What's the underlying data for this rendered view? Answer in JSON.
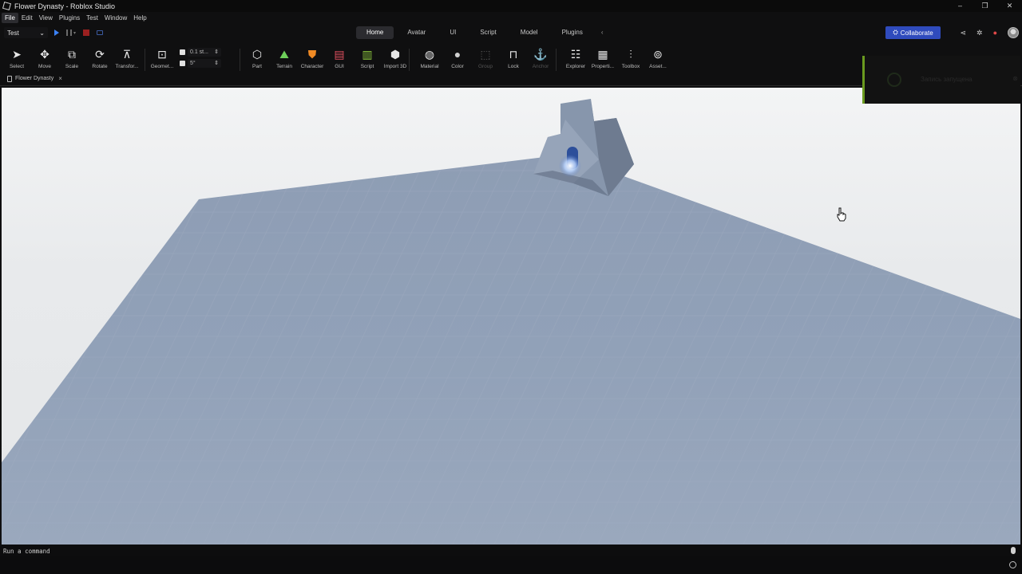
{
  "window": {
    "title": "Flower Dynasty - Roblox Studio",
    "controls": [
      "–",
      "❐",
      "✕"
    ]
  },
  "menu": [
    "File",
    "Edit",
    "View",
    "Plugins",
    "Test",
    "Window",
    "Help"
  ],
  "mode_select": {
    "value": "Test"
  },
  "ribbon_tabs": [
    "Home",
    "Avatar",
    "UI",
    "Script",
    "Model",
    "Plugins"
  ],
  "ribbon_more": "‹",
  "collaborate_label": "Collaborate",
  "tools": {
    "select": "Select",
    "move": "Move",
    "scale": "Scale",
    "rotate": "Rotate",
    "transform": "Transfor...",
    "geometry": "Geomet...",
    "part": "Part",
    "terrain": "Terrain",
    "character": "Character",
    "gui": "GUI",
    "script": "Script",
    "import3d": "Import 3D",
    "material": "Material",
    "color": "Color",
    "group": "Group",
    "lock": "Lock",
    "anchor": "Anchor",
    "explorer": "Explorer",
    "properties": "Properti...",
    "toolbox": "Toolbox",
    "assets": "Asset..."
  },
  "snap": {
    "move_increment": "0.1 st...",
    "rotate_increment": "5°"
  },
  "document_tab": {
    "label": "Flower Dynasty"
  },
  "toast": {
    "message": "Запись запущена"
  },
  "command_bar": {
    "placeholder": "Run a command"
  },
  "colors": {
    "accent": "#2f4bbd",
    "play": "#3b82f6",
    "stop": "#9b2020",
    "baseplate": "#8ea0b8"
  }
}
